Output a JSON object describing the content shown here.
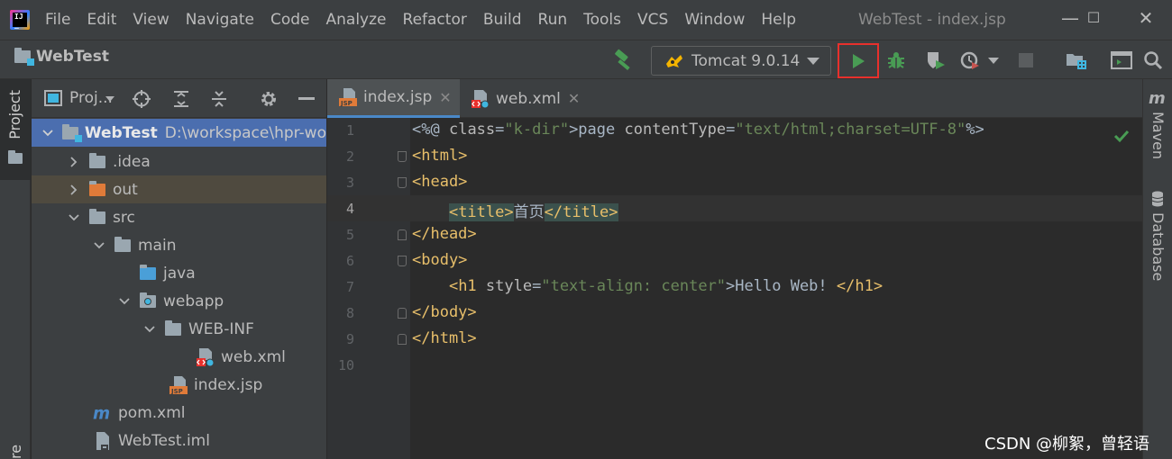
{
  "menubar": {
    "items": [
      "File",
      "Edit",
      "View",
      "Navigate",
      "Code",
      "Analyze",
      "Refactor",
      "Build",
      "Run",
      "Tools",
      "VCS",
      "Window",
      "Help"
    ],
    "window_title": "WebTest - index.jsp",
    "minimize": "—",
    "maximize": "☐",
    "close": "✕"
  },
  "navbar": {
    "project_name": "WebTest",
    "run_config": "Tomcat 9.0.14"
  },
  "left_strip": {
    "project_tab": "Project",
    "bottom_tab": "re"
  },
  "project_panel": {
    "view_selector": "Proj..."
  },
  "tree": [
    {
      "label": "WebTest",
      "path": "D:\\workspace\\hpr-wo",
      "icon": "module-folder-icon",
      "expanded": true
    },
    {
      "label": ".idea",
      "icon": "folder-icon",
      "expanded": false
    },
    {
      "label": "out",
      "icon": "excluded-folder-icon",
      "expanded": false
    },
    {
      "label": "src",
      "icon": "folder-icon",
      "expanded": true
    },
    {
      "label": "main",
      "icon": "folder-icon",
      "expanded": true
    },
    {
      "label": "java",
      "icon": "source-folder-icon"
    },
    {
      "label": "webapp",
      "icon": "web-folder-icon",
      "expanded": true
    },
    {
      "label": "WEB-INF",
      "icon": "folder-icon",
      "expanded": true
    },
    {
      "label": "web.xml",
      "icon": "web-xml-icon"
    },
    {
      "label": "index.jsp",
      "icon": "jsp-file-icon"
    },
    {
      "label": "pom.xml",
      "icon": "maven-icon"
    },
    {
      "label": "WebTest.iml",
      "icon": "iml-file-icon"
    }
  ],
  "tabs": [
    {
      "label": "index.jsp",
      "close": "✕",
      "active": true
    },
    {
      "label": "web.xml",
      "close": "✕",
      "active": false
    }
  ],
  "editor": {
    "line_numbers": [
      "1",
      "2",
      "3",
      "4",
      "5",
      "6",
      "7",
      "8",
      "9",
      "10"
    ],
    "current_line": 4,
    "lines": [
      "<%@ page contentType=\"text/html;charset=UTF-8\"%>",
      "<html>",
      "<head>",
      "    <title>首页</title>",
      "</head>",
      "<body>",
      "    <h1 style=\"text-align: center\">Hello Web! </h1>",
      "</body>",
      "</html>",
      ""
    ]
  },
  "right_strip": {
    "maven_tab": "Maven",
    "database_tab": "Database"
  },
  "watermark": "CSDN @柳絮，曾轻语",
  "colors": {
    "accent_run": "#499c54",
    "highlight_box": "#e8302c",
    "selection": "#4b6eaf",
    "tag": "#e8bf6a",
    "string": "#6a8759",
    "keyword": "#cc7832"
  }
}
